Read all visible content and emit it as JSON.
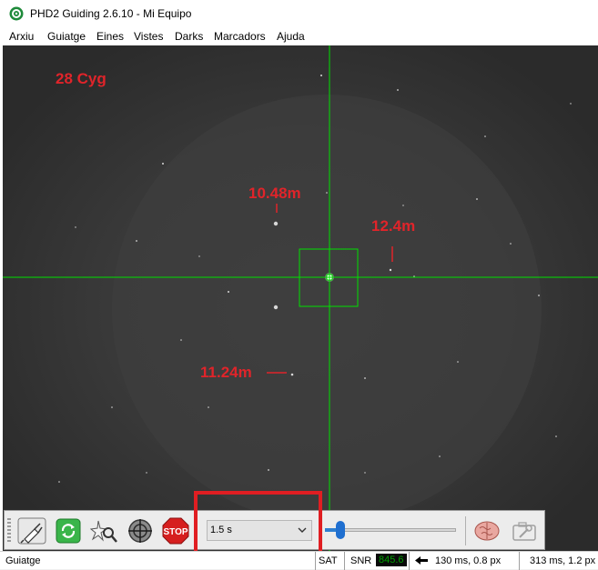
{
  "window": {
    "title": "PHD2 Guiding 2.6.10 - Mi Equipo",
    "icon": "phd2-target-icon",
    "accent_color": "#1e8a3a"
  },
  "menu": {
    "items": [
      "Arxiu",
      "Guiatge",
      "Eines",
      "Vistes",
      "Darks",
      "Marcadors",
      "Ajuda"
    ]
  },
  "viewport": {
    "object_name": "28 Cyg",
    "star_labels": [
      "10.48m",
      "12.4m",
      "11.24m"
    ],
    "label_color": "#e0242a",
    "crosshair_color": "#00e000"
  },
  "toolbar": {
    "buttons": [
      {
        "name": "connect-gear-button",
        "icon": "usb-plug-icon"
      },
      {
        "name": "loop-button",
        "icon": "loop-arrows-icon"
      },
      {
        "name": "auto-select-star-button",
        "icon": "star-magnifier-icon"
      },
      {
        "name": "guide-button",
        "icon": "target-crosshair-icon"
      },
      {
        "name": "stop-button",
        "icon": "stop-sign-icon",
        "label": "STOP"
      }
    ],
    "exposure": {
      "selected": "1.5 s"
    },
    "gamma_slider": {
      "value": 0.12
    },
    "brain_icon": "brain-icon",
    "camera_settings_icon": "camera-wrench-icon"
  },
  "statusbar": {
    "mode": "Guiatge",
    "sat_label": "SAT",
    "snr_label": "SNR",
    "snr_value": "845.6",
    "snr_color": "#00a000",
    "guide_pulse": "130 ms, 0.8 px",
    "guide_pulse_2": "313 ms, 1.2 px"
  }
}
